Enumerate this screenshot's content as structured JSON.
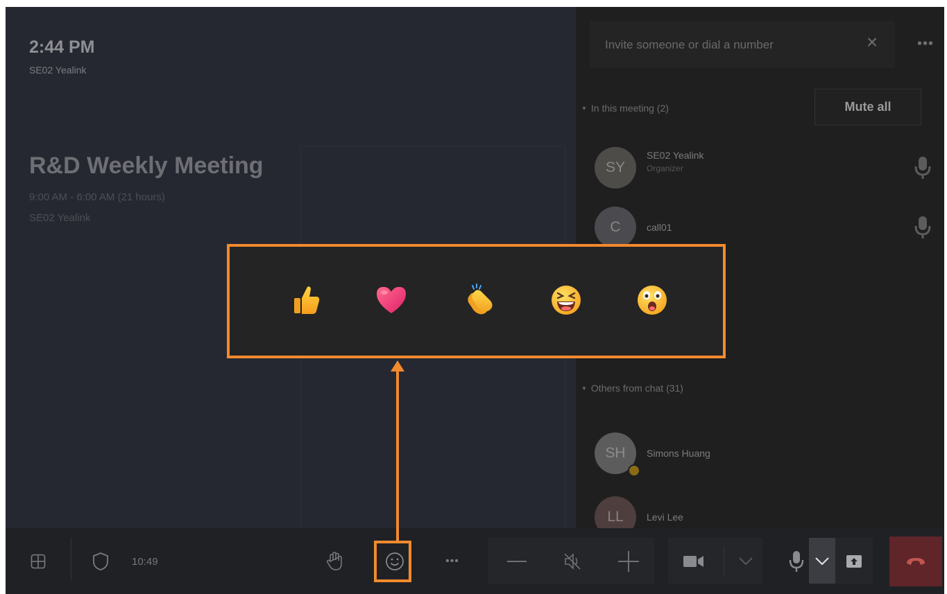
{
  "stage": {
    "clock": "2:44 PM",
    "host": "SE02 Yealink",
    "meeting_title": "R&D Weekly Meeting",
    "meeting_time": "9:00 AM - 6:00 AM (21 hours)",
    "meeting_organizer": "SE02 Yealink"
  },
  "panel": {
    "invite_placeholder": "Invite someone or dial a number",
    "in_meeting_header": "In this meeting (2)",
    "mute_all_label": "Mute all",
    "participants": [
      {
        "initials": "SY",
        "name": "SE02 Yealink",
        "role": "Organizer"
      },
      {
        "initials": "C",
        "name": "call01"
      }
    ],
    "others_header": "Others from chat (31)",
    "others": [
      {
        "initials": "SH",
        "name": "Simons Huang",
        "status": "away"
      },
      {
        "initials": "LL",
        "name": "Levi Lee"
      }
    ]
  },
  "toolbar": {
    "call_timer": "10:49",
    "icons": [
      "layout-icon",
      "shield-icon",
      "raise-hand-icon",
      "emoji-icon",
      "more-icon",
      "volume-down-icon",
      "speaker-muted-icon",
      "volume-up-icon",
      "camera-icon",
      "chevron-down-icon",
      "microphone-icon",
      "chevron-down-icon",
      "share-screen-icon",
      "hang-up-icon"
    ]
  },
  "reactions": [
    "like",
    "heart",
    "applause",
    "laugh",
    "surprised"
  ],
  "colors": {
    "highlight": "#f28a2e",
    "stage_bg": "#262831",
    "panel_bg": "#1f1f1f",
    "hangup": "#5f2529"
  }
}
